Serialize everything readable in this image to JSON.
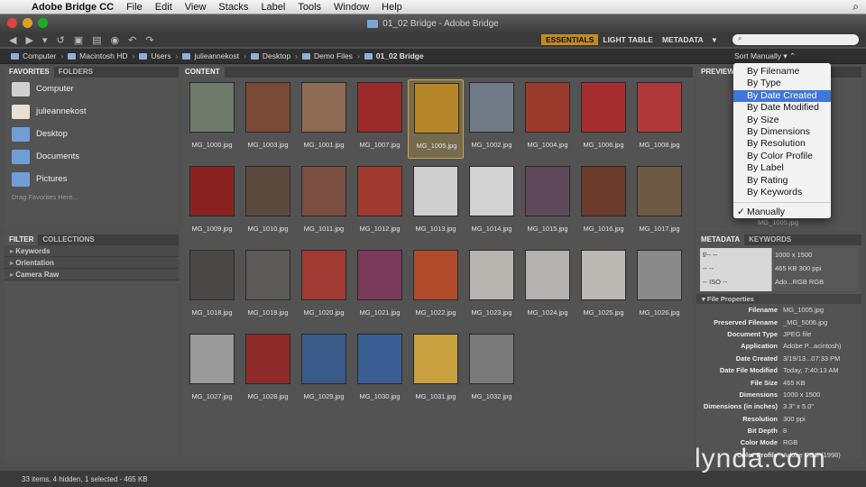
{
  "menubar": {
    "app_name": "Adobe Bridge CC",
    "items": [
      "File",
      "Edit",
      "View",
      "Stacks",
      "Label",
      "Tools",
      "Window",
      "Help"
    ]
  },
  "window": {
    "title": "01_02 Bridge - Adobe Bridge"
  },
  "workspaces": [
    "ESSENTIALS",
    "LIGHT TABLE",
    "METADATA"
  ],
  "path": [
    "Computer",
    "Macintosh HD",
    "Users",
    "julieannekost",
    "Desktop",
    "Demo Files",
    "01_02 Bridge"
  ],
  "sort": {
    "label": "Sort Manually"
  },
  "favorites": {
    "tabs": [
      "FAVORITES",
      "FOLDERS"
    ],
    "items": [
      "Computer",
      "julieannekost",
      "Desktop",
      "Documents",
      "Pictures"
    ],
    "hint": "Drag Favorites Here..."
  },
  "filter": {
    "tabs": [
      "FILTER",
      "COLLECTIONS"
    ],
    "rows": [
      "Keywords",
      "Orientation",
      "Camera Raw"
    ]
  },
  "content": {
    "tab": "CONTENT",
    "thumbs": [
      {
        "name": "MG_1000.jpg",
        "color": "#6e7a6a"
      },
      {
        "name": "MG_1003.jpg",
        "color": "#7a4a36"
      },
      {
        "name": "MG_1001.jpg",
        "color": "#8d6b55"
      },
      {
        "name": "MG_1007.jpg",
        "color": "#9a2a2a"
      },
      {
        "name": "MG_1005.jpg",
        "color": "#b8862a"
      },
      {
        "name": "MG_1002.jpg",
        "color": "#6f7a86"
      },
      {
        "name": "MG_1004.jpg",
        "color": "#9a3a2a"
      },
      {
        "name": "MG_1006.jpg",
        "color": "#a62e2e"
      },
      {
        "name": "MG_1008.jpg",
        "color": "#b03a3a"
      },
      {
        "name": "MG_1009.jpg",
        "color": "#8a2222"
      },
      {
        "name": "MG_1010.jpg",
        "color": "#5a4a3e"
      },
      {
        "name": "MG_1011.jpg",
        "color": "#7a4e40"
      },
      {
        "name": "MG_1012.jpg",
        "color": "#a03a30"
      },
      {
        "name": "MG_1013.jpg",
        "color": "#cfcfcf"
      },
      {
        "name": "MG_1014.jpg",
        "color": "#d2d2d2"
      },
      {
        "name": "MG_1015.jpg",
        "color": "#5e4a58"
      },
      {
        "name": "MG_1016.jpg",
        "color": "#6a3a2a"
      },
      {
        "name": "MG_1017.jpg",
        "color": "#6e5a44"
      },
      {
        "name": "MG_1018.jpg",
        "color": "#4a4844"
      },
      {
        "name": "MG_1019.jpg",
        "color": "#5e5a58"
      },
      {
        "name": "MG_1020.jpg",
        "color": "#a03a32"
      },
      {
        "name": "MG_1021.jpg",
        "color": "#7a3a5a"
      },
      {
        "name": "MG_1022.jpg",
        "color": "#b04a2a"
      },
      {
        "name": "MG_1023.jpg",
        "color": "#b8b4b0"
      },
      {
        "name": "MG_1024.jpg",
        "color": "#b4b2ae"
      },
      {
        "name": "MG_1025.jpg",
        "color": "#bcb8b4"
      },
      {
        "name": "MG_1026.jpg",
        "color": "#8a8a8a"
      },
      {
        "name": "MG_1027.jpg",
        "color": "#9a9a9a"
      },
      {
        "name": "MG_1028.jpg",
        "color": "#8e2a2a"
      },
      {
        "name": "MG_1029.jpg",
        "color": "#3a5a8a"
      },
      {
        "name": "MG_1030.jpg",
        "color": "#3a5e94"
      },
      {
        "name": "MG_1031.jpg",
        "color": "#c8a040"
      },
      {
        "name": "MG_1032.jpg",
        "color": "#7a7a7a"
      }
    ]
  },
  "preview": {
    "tab": "PREVIEW",
    "caption": "MG_1005.jpg"
  },
  "metadata": {
    "tabs": [
      "METADATA",
      "KEYWORDS"
    ],
    "summary": {
      "left": [
        "f/--  --",
        "--  --",
        "--  ISO --"
      ],
      "right": [
        "1000 x 1500",
        "465 KB   300 ppi",
        "Ado...RGB  RGB"
      ]
    },
    "section": "File Properties",
    "rows": [
      {
        "k": "Filename",
        "v": "MG_1005.jpg"
      },
      {
        "k": "Preserved Filename",
        "v": "_MG_5006.jpg"
      },
      {
        "k": "Document Type",
        "v": "JPEG file"
      },
      {
        "k": "Application",
        "v": "Adobe P...acintosh)"
      },
      {
        "k": "Date Created",
        "v": "3/19/13...07:33 PM"
      },
      {
        "k": "Date File Modified",
        "v": "Today, 7:40:13 AM"
      },
      {
        "k": "File Size",
        "v": "465 KB"
      },
      {
        "k": "Dimensions",
        "v": "1000 x 1500"
      },
      {
        "k": "Dimensions (in inches)",
        "v": "3.3\" x 5.0\""
      },
      {
        "k": "Resolution",
        "v": "300 ppi"
      },
      {
        "k": "Bit Depth",
        "v": "8"
      },
      {
        "k": "Color Mode",
        "v": "RGB"
      },
      {
        "k": "Color Profile",
        "v": "Adobe RGB (1998)"
      }
    ]
  },
  "sort_menu": {
    "items": [
      "By Filename",
      "By Type",
      "By Date Created",
      "By Date Modified",
      "By Size",
      "By Dimensions",
      "By Resolution",
      "By Color Profile",
      "By Label",
      "By Rating",
      "By Keywords"
    ],
    "highlighted": "By Date Created",
    "checked": "Manually"
  },
  "status": {
    "text": "33 items, 4 hidden, 1 selected - 465 KB"
  },
  "watermark": "lynda.com",
  "search": {
    "placeholder": ""
  }
}
